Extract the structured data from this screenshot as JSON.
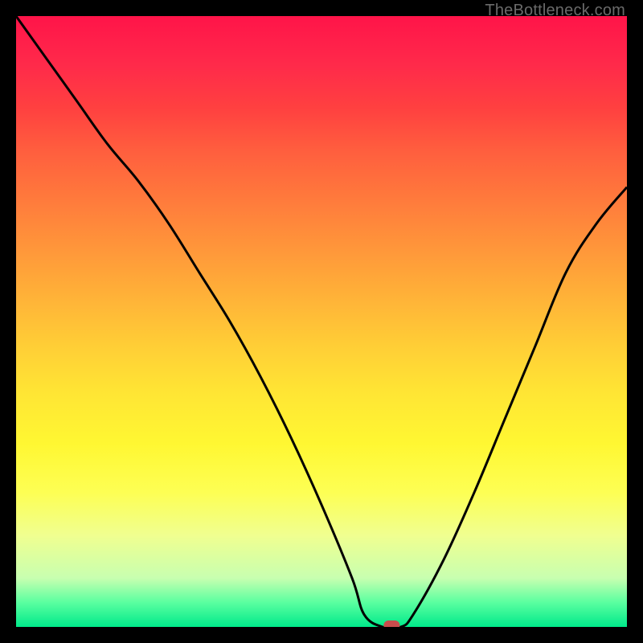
{
  "watermark": "TheBottleneck.com",
  "chart_data": {
    "type": "line",
    "title": "",
    "xlabel": "",
    "ylabel": "",
    "xlim": [
      0,
      100
    ],
    "ylim": [
      0,
      100
    ],
    "series": [
      {
        "name": "curve",
        "x": [
          0,
          5,
          10,
          15,
          20,
          25,
          30,
          35,
          40,
          45,
          50,
          55,
          57,
          60,
          63,
          65,
          70,
          75,
          80,
          85,
          90,
          95,
          100
        ],
        "y": [
          100,
          93,
          86,
          79,
          73,
          66,
          58,
          50,
          41,
          31,
          20,
          8,
          2,
          0,
          0,
          2,
          11,
          22,
          34,
          46,
          58,
          66,
          72
        ]
      }
    ],
    "marker": {
      "x": 61.5,
      "y": 0,
      "color": "#c94d4d"
    },
    "gradient_stops": [
      {
        "pct": 0,
        "color": "#ff1449"
      },
      {
        "pct": 50,
        "color": "#ffd436"
      },
      {
        "pct": 100,
        "color": "#00e98a"
      }
    ]
  }
}
